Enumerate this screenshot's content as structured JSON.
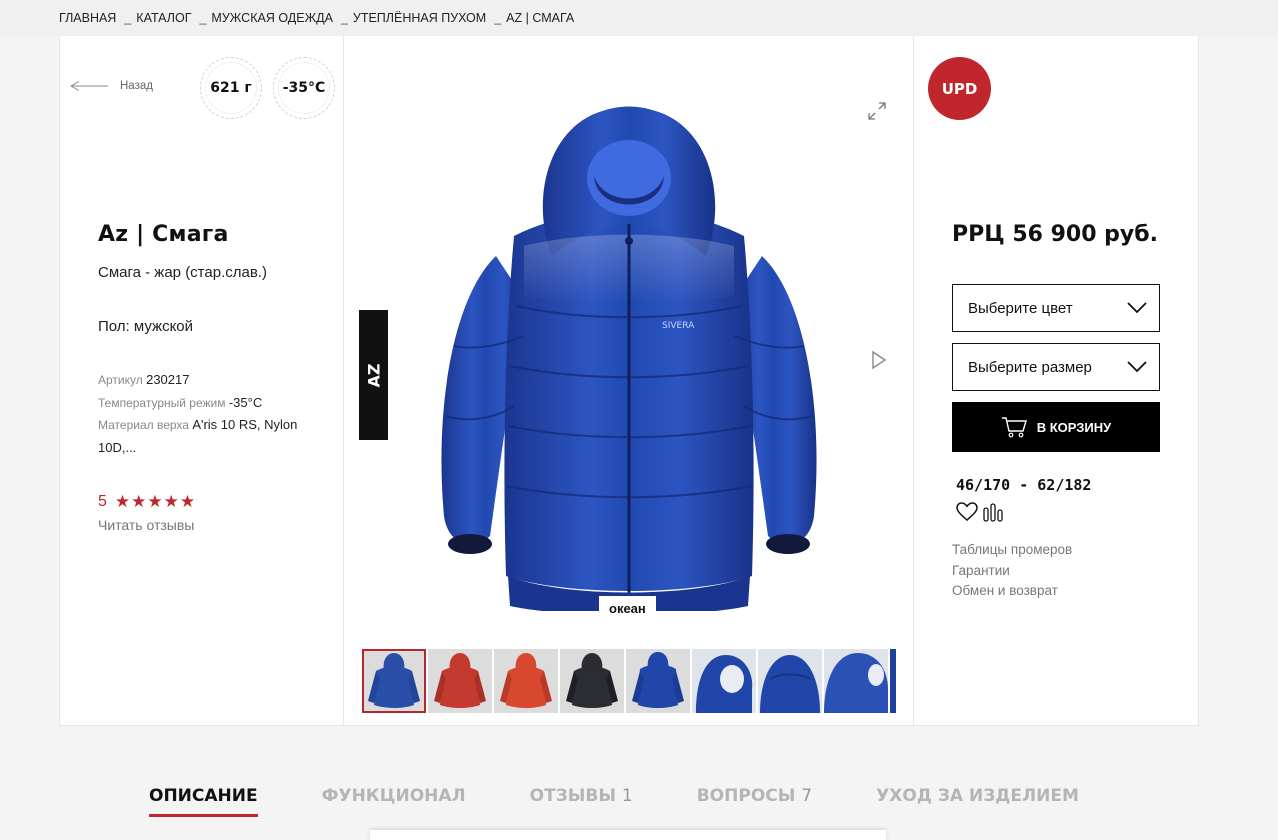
{
  "breadcrumb": [
    "ГЛАВНАЯ",
    "КАТАЛОГ",
    "МУЖСКАЯ ОДЕЖДА",
    "УТЕПЛЁННАЯ ПУХОМ",
    "AZ | СМАГА"
  ],
  "left": {
    "back_label": "Назад",
    "weight": "621 г",
    "temperature": "-35°C",
    "title": "Az | Смага",
    "subtitle": "Смага - жар (стар.слав.)",
    "gender": "Пол: мужской",
    "article_label": "Артикул",
    "article_value": "230217",
    "temp_label": "Температурный режим",
    "temp_value": "-35°C",
    "material_label": "Материал верха",
    "material_value": "A'ris 10 RS, Nylon 10D,...",
    "rating_value": "5",
    "rating_stars": "★★★★★",
    "read_reviews": "Читать отзывы"
  },
  "center": {
    "az_tab": "AZ",
    "color_name": "океан",
    "brand_mark": "SIVERA",
    "thumbnails": [
      {
        "name": "blue-front",
        "color": "#2a4fa8",
        "active": true
      },
      {
        "name": "red-front",
        "color": "#c53a2e"
      },
      {
        "name": "orange-front",
        "color": "#d8482f"
      },
      {
        "name": "black-front",
        "color": "#2b2d33"
      },
      {
        "name": "blue-back",
        "color": "#1f46a8"
      },
      {
        "name": "blue-hood-side",
        "color": "#1f46a8"
      },
      {
        "name": "blue-hood-back",
        "color": "#1f46a8"
      },
      {
        "name": "blue-hood-detail",
        "color": "#2a52b6"
      }
    ]
  },
  "right": {
    "badge": "UPD",
    "price": "РРЦ 56 900 руб.",
    "color_select": "Выберите цвет",
    "size_select": "Выберите размер",
    "cart_button": "В КОРЗИНУ",
    "size_range": "46/170 - 62/182",
    "links": [
      "Таблицы промеров",
      "Гарантии",
      "Обмен и возврат"
    ]
  },
  "tabs": [
    {
      "label": "ОПИСАНИЕ",
      "count": "",
      "active": true
    },
    {
      "label": "ФУНКЦИОНАЛ",
      "count": ""
    },
    {
      "label": "ОТЗЫВЫ",
      "count": "1"
    },
    {
      "label": "ВОПРОСЫ",
      "count": "7"
    },
    {
      "label": "УХОД ЗА ИЗДЕЛИЕМ",
      "count": ""
    }
  ],
  "colors": {
    "accent_red": "#c0272d",
    "jacket_blue": "#2346a8"
  }
}
